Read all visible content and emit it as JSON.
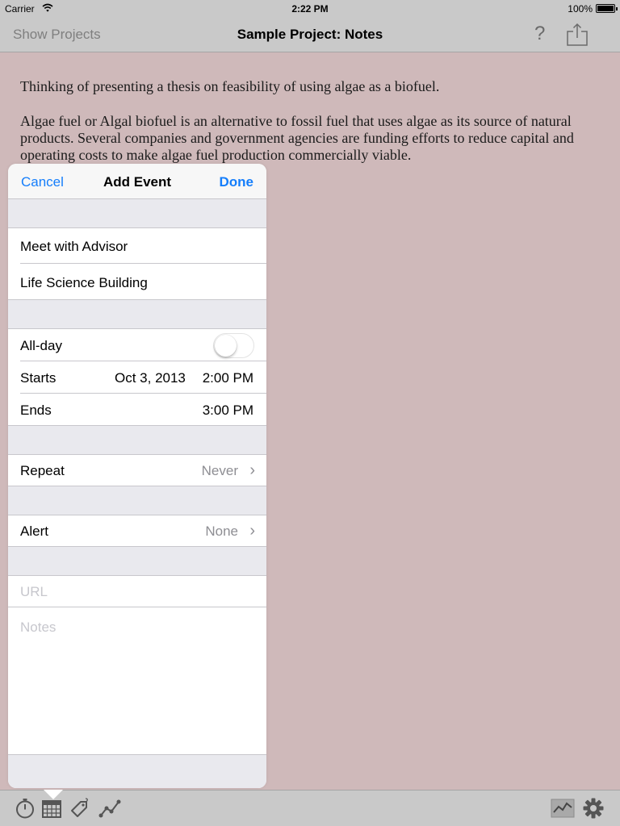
{
  "status_bar": {
    "carrier": "Carrier",
    "time": "2:22 PM",
    "battery": "100%",
    "icons": [
      "wifi-icon",
      "battery-icon"
    ]
  },
  "nav": {
    "left_button": "Show Projects",
    "title": "Sample Project: Notes",
    "help": "?",
    "icons": [
      "help-icon",
      "share-icon"
    ]
  },
  "notes": {
    "paragraphs": [
      "Thinking of presenting a thesis on feasibility of using algae as a biofuel.",
      "Algae fuel or Algal biofuel is an alternative to fossil fuel that uses algae as its source of natural products. Several companies and government agencies are funding efforts to reduce capital and operating costs to make algae fuel production commercially viable."
    ]
  },
  "add_event": {
    "cancel": "Cancel",
    "title": "Add Event",
    "done": "Done",
    "event_title": "Meet with Advisor",
    "location": "Life Science Building",
    "all_day_label": "All-day",
    "all_day_on": false,
    "starts_label": "Starts",
    "starts_date": "Oct 3, 2013",
    "starts_time": "2:00 PM",
    "ends_label": "Ends",
    "ends_time": "3:00 PM",
    "repeat_label": "Repeat",
    "repeat_value": "Never",
    "alert_label": "Alert",
    "alert_value": "None",
    "url_placeholder": "URL",
    "notes_placeholder": "Notes",
    "chevron": "›"
  },
  "toolbar": {
    "left_icons": [
      "stopwatch-icon",
      "calendar-icon",
      "price-tag-icon",
      "line-graph-icon"
    ],
    "right_icons": [
      "chart-icon",
      "gear-icon"
    ]
  },
  "colors": {
    "background": "#cfb9ba",
    "bar": "#c9c9c9",
    "accent": "#157efb"
  }
}
